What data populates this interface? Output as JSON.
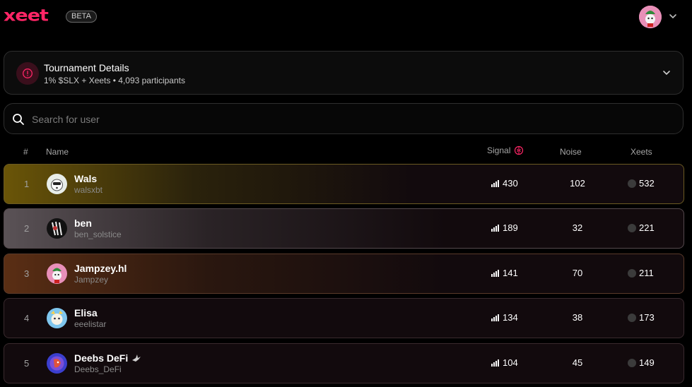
{
  "header": {
    "logo_text": "xeet",
    "beta_label": "BETA",
    "avatar_icon": "user-avatar",
    "menu_icon": "chevron-down-icon"
  },
  "tournament": {
    "title": "Tournament Details",
    "subtitle": "1% $SLX + Xeets • 4,093 participants",
    "icon": "info-icon",
    "accent_color": "#ff2566"
  },
  "search": {
    "placeholder": "Search for user",
    "value": ""
  },
  "table": {
    "columns": {
      "rank": "#",
      "name": "Name",
      "signal": "Signal",
      "noise": "Noise",
      "xeets": "Xeets"
    },
    "rows": [
      {
        "rank": "1",
        "name": "Wals",
        "handle": "walsxbt",
        "signal": "430",
        "noise": "102",
        "xeets": "532",
        "badge": ""
      },
      {
        "rank": "2",
        "name": "ben",
        "handle": "ben_solstice",
        "signal": "189",
        "noise": "32",
        "xeets": "221",
        "badge": ""
      },
      {
        "rank": "3",
        "name": "Jampzey.hl",
        "handle": "Jampzey",
        "signal": "141",
        "noise": "70",
        "xeets": "211",
        "badge": ""
      },
      {
        "rank": "4",
        "name": "Elisa",
        "handle": "eeelistar",
        "signal": "134",
        "noise": "38",
        "xeets": "173",
        "badge": ""
      },
      {
        "rank": "5",
        "name": "Deebs DeFi",
        "handle": "Deebs_DeFi",
        "signal": "104",
        "noise": "45",
        "xeets": "149",
        "badge": "bird-icon"
      }
    ]
  },
  "colors": {
    "gold": "#6a5508",
    "silver": "#5a5256",
    "bronze": "#5a2e14",
    "brand": "#ff2566"
  }
}
